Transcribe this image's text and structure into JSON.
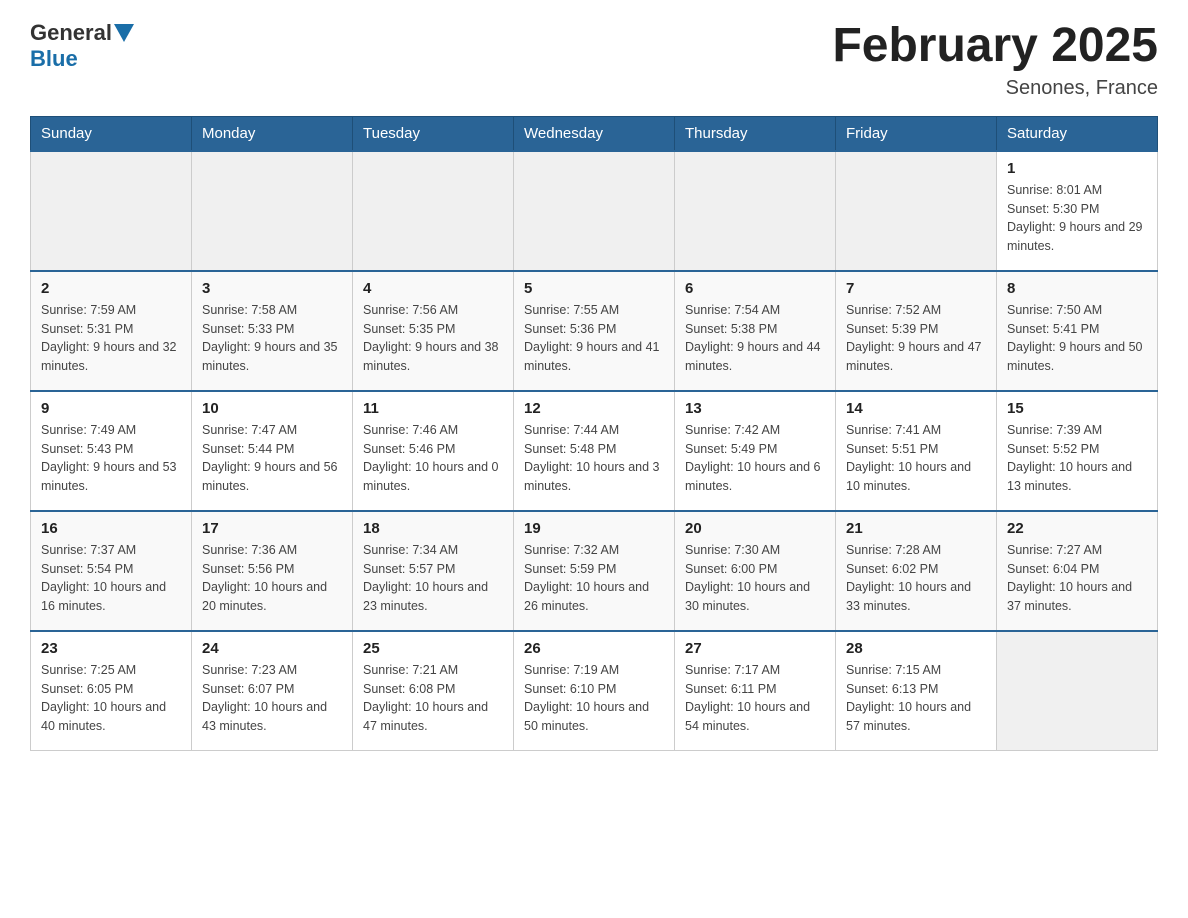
{
  "header": {
    "logo_general": "General",
    "logo_blue": "Blue",
    "title": "February 2025",
    "subtitle": "Senones, France"
  },
  "days_of_week": [
    "Sunday",
    "Monday",
    "Tuesday",
    "Wednesday",
    "Thursday",
    "Friday",
    "Saturday"
  ],
  "weeks": [
    [
      {
        "day": "",
        "info": ""
      },
      {
        "day": "",
        "info": ""
      },
      {
        "day": "",
        "info": ""
      },
      {
        "day": "",
        "info": ""
      },
      {
        "day": "",
        "info": ""
      },
      {
        "day": "",
        "info": ""
      },
      {
        "day": "1",
        "info": "Sunrise: 8:01 AM\nSunset: 5:30 PM\nDaylight: 9 hours and 29 minutes."
      }
    ],
    [
      {
        "day": "2",
        "info": "Sunrise: 7:59 AM\nSunset: 5:31 PM\nDaylight: 9 hours and 32 minutes."
      },
      {
        "day": "3",
        "info": "Sunrise: 7:58 AM\nSunset: 5:33 PM\nDaylight: 9 hours and 35 minutes."
      },
      {
        "day": "4",
        "info": "Sunrise: 7:56 AM\nSunset: 5:35 PM\nDaylight: 9 hours and 38 minutes."
      },
      {
        "day": "5",
        "info": "Sunrise: 7:55 AM\nSunset: 5:36 PM\nDaylight: 9 hours and 41 minutes."
      },
      {
        "day": "6",
        "info": "Sunrise: 7:54 AM\nSunset: 5:38 PM\nDaylight: 9 hours and 44 minutes."
      },
      {
        "day": "7",
        "info": "Sunrise: 7:52 AM\nSunset: 5:39 PM\nDaylight: 9 hours and 47 minutes."
      },
      {
        "day": "8",
        "info": "Sunrise: 7:50 AM\nSunset: 5:41 PM\nDaylight: 9 hours and 50 minutes."
      }
    ],
    [
      {
        "day": "9",
        "info": "Sunrise: 7:49 AM\nSunset: 5:43 PM\nDaylight: 9 hours and 53 minutes."
      },
      {
        "day": "10",
        "info": "Sunrise: 7:47 AM\nSunset: 5:44 PM\nDaylight: 9 hours and 56 minutes."
      },
      {
        "day": "11",
        "info": "Sunrise: 7:46 AM\nSunset: 5:46 PM\nDaylight: 10 hours and 0 minutes."
      },
      {
        "day": "12",
        "info": "Sunrise: 7:44 AM\nSunset: 5:48 PM\nDaylight: 10 hours and 3 minutes."
      },
      {
        "day": "13",
        "info": "Sunrise: 7:42 AM\nSunset: 5:49 PM\nDaylight: 10 hours and 6 minutes."
      },
      {
        "day": "14",
        "info": "Sunrise: 7:41 AM\nSunset: 5:51 PM\nDaylight: 10 hours and 10 minutes."
      },
      {
        "day": "15",
        "info": "Sunrise: 7:39 AM\nSunset: 5:52 PM\nDaylight: 10 hours and 13 minutes."
      }
    ],
    [
      {
        "day": "16",
        "info": "Sunrise: 7:37 AM\nSunset: 5:54 PM\nDaylight: 10 hours and 16 minutes."
      },
      {
        "day": "17",
        "info": "Sunrise: 7:36 AM\nSunset: 5:56 PM\nDaylight: 10 hours and 20 minutes."
      },
      {
        "day": "18",
        "info": "Sunrise: 7:34 AM\nSunset: 5:57 PM\nDaylight: 10 hours and 23 minutes."
      },
      {
        "day": "19",
        "info": "Sunrise: 7:32 AM\nSunset: 5:59 PM\nDaylight: 10 hours and 26 minutes."
      },
      {
        "day": "20",
        "info": "Sunrise: 7:30 AM\nSunset: 6:00 PM\nDaylight: 10 hours and 30 minutes."
      },
      {
        "day": "21",
        "info": "Sunrise: 7:28 AM\nSunset: 6:02 PM\nDaylight: 10 hours and 33 minutes."
      },
      {
        "day": "22",
        "info": "Sunrise: 7:27 AM\nSunset: 6:04 PM\nDaylight: 10 hours and 37 minutes."
      }
    ],
    [
      {
        "day": "23",
        "info": "Sunrise: 7:25 AM\nSunset: 6:05 PM\nDaylight: 10 hours and 40 minutes."
      },
      {
        "day": "24",
        "info": "Sunrise: 7:23 AM\nSunset: 6:07 PM\nDaylight: 10 hours and 43 minutes."
      },
      {
        "day": "25",
        "info": "Sunrise: 7:21 AM\nSunset: 6:08 PM\nDaylight: 10 hours and 47 minutes."
      },
      {
        "day": "26",
        "info": "Sunrise: 7:19 AM\nSunset: 6:10 PM\nDaylight: 10 hours and 50 minutes."
      },
      {
        "day": "27",
        "info": "Sunrise: 7:17 AM\nSunset: 6:11 PM\nDaylight: 10 hours and 54 minutes."
      },
      {
        "day": "28",
        "info": "Sunrise: 7:15 AM\nSunset: 6:13 PM\nDaylight: 10 hours and 57 minutes."
      },
      {
        "day": "",
        "info": ""
      }
    ]
  ]
}
